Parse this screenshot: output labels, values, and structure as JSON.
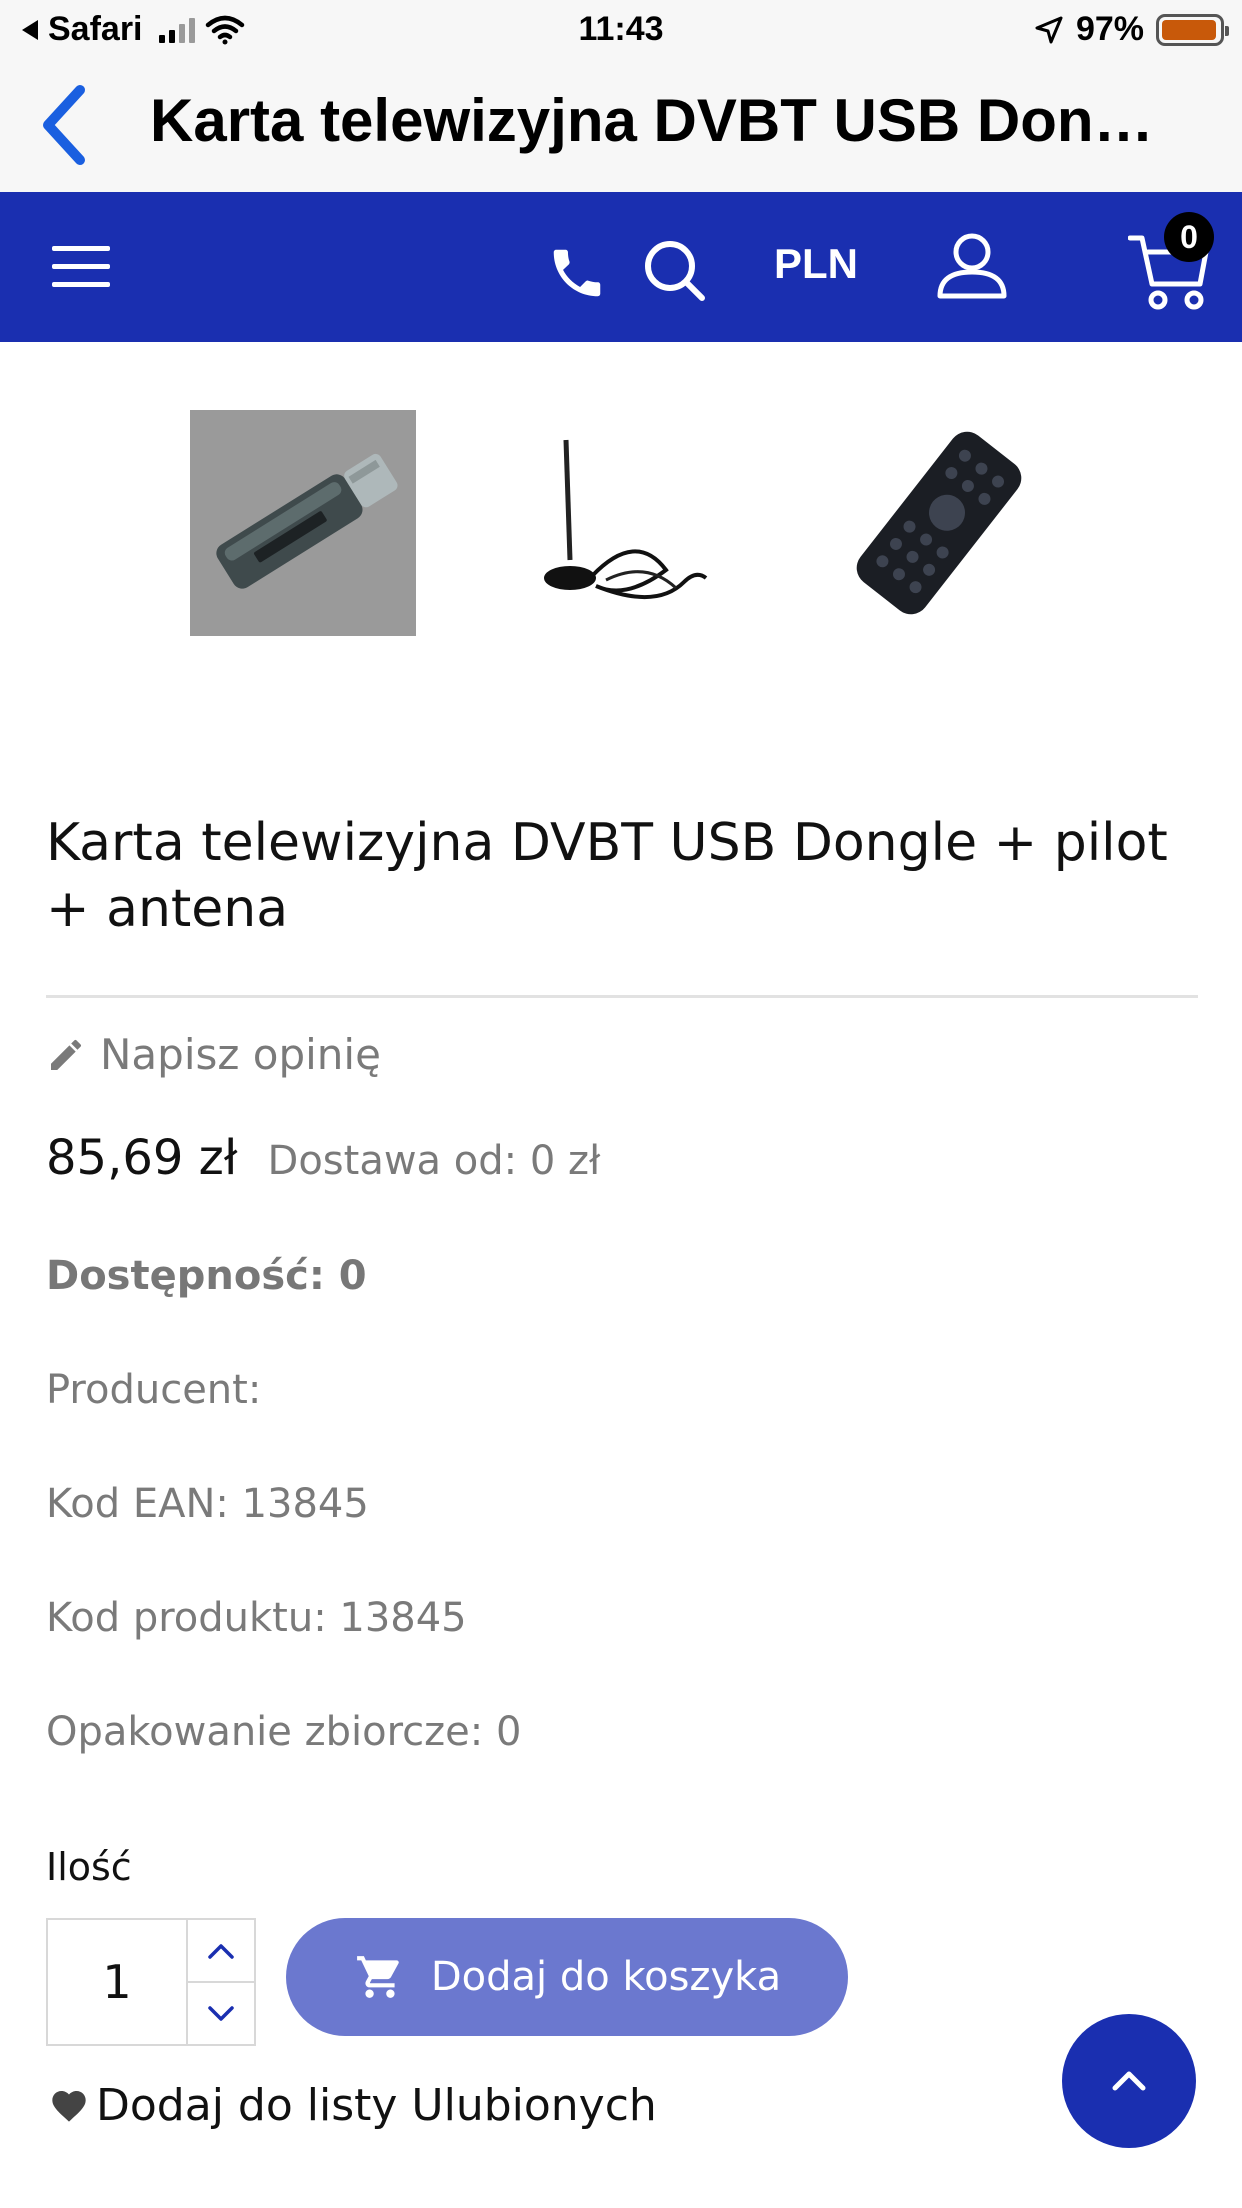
{
  "status_bar": {
    "back_app": "Safari",
    "time": "11:43",
    "battery": "97%",
    "battery_level": 0.97,
    "battery_color": "#c8590a"
  },
  "nav": {
    "title": "Karta telewizyjna DVBT USB Don…"
  },
  "header": {
    "accent_color": "#1a2fb0",
    "currency": "PLN",
    "cart_count": "0",
    "icons": [
      "menu-icon",
      "phone-icon",
      "search-icon",
      "user-icon",
      "cart-icon"
    ]
  },
  "gallery": {
    "thumbnails": [
      "usb-dongle",
      "antenna",
      "remote-control"
    ]
  },
  "product": {
    "title": "Karta telewizyjna DVBT USB Dongle + pilot + antena",
    "review_link": "Napisz opinię",
    "price": "85,69 zł",
    "shipping": "Dostawa od: 0 zł",
    "availability": "Dostępność: 0",
    "producer": "Producent:",
    "ean": "Kod EAN: 13845",
    "code": "Kod produktu: 13845",
    "package": "Opakowanie zbiorcze: 0"
  },
  "purchase": {
    "qty_label": "Ilość",
    "qty_value": "1",
    "add_to_cart": "Dodaj do koszyka",
    "button_color": "#6b78cf",
    "favorites": "Dodaj do listy Ulubionych"
  }
}
